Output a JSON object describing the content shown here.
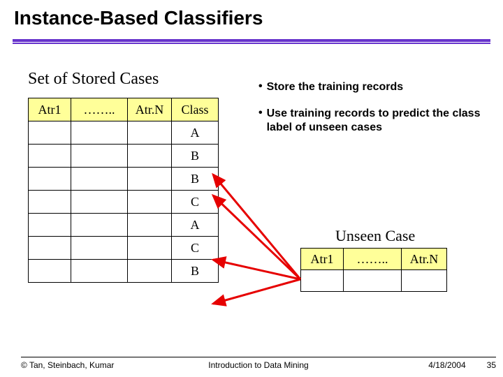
{
  "title": "Instance-Based Classifiers",
  "stored_caption": "Set of Stored Cases",
  "unseen_caption": "Unseen Case",
  "stored_table": {
    "headers": [
      "Atr1",
      "……..",
      "Atr.N",
      "Class"
    ],
    "rows": [
      [
        "",
        "",
        "",
        "A"
      ],
      [
        "",
        "",
        "",
        "B"
      ],
      [
        "",
        "",
        "",
        "B"
      ],
      [
        "",
        "",
        "",
        "C"
      ],
      [
        "",
        "",
        "",
        "A"
      ],
      [
        "",
        "",
        "",
        "C"
      ],
      [
        "",
        "",
        "",
        "B"
      ]
    ]
  },
  "unseen_table": {
    "headers": [
      "Atr1",
      "……..",
      "Atr.N"
    ],
    "row": [
      "",
      "",
      ""
    ]
  },
  "bullets": [
    "Store the training records",
    "Use training records to predict the class label of unseen cases"
  ],
  "footer": {
    "copyright": "© Tan, Steinbach, Kumar",
    "center": "Introduction to Data Mining",
    "date": "4/18/2004",
    "page": "35"
  }
}
